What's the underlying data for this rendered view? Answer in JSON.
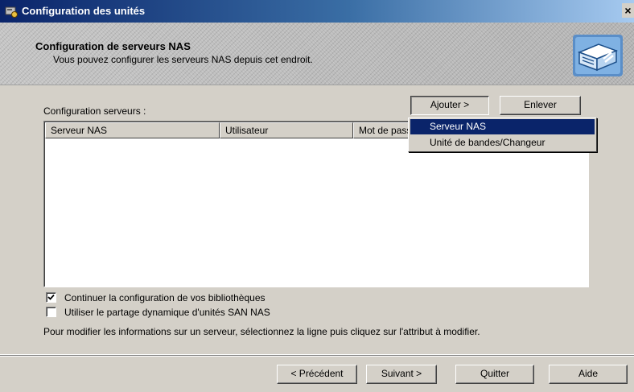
{
  "window": {
    "title": "Configuration des unités",
    "close_glyph": "×"
  },
  "header": {
    "title": "Configuration de serveurs NAS",
    "subtitle": "Vous pouvez configurer les serveurs NAS depuis cet endroit.",
    "art_icon": "tape-library-icon"
  },
  "main": {
    "list_label": "Configuration serveurs :",
    "buttons": {
      "add": "Ajouter >",
      "remove": "Enlever"
    },
    "columns": [
      "Serveur NAS",
      "Utilisateur",
      "Mot de passe"
    ],
    "rows": [],
    "add_menu": {
      "items": [
        "Serveur NAS",
        "Unité de bandes/Changeur"
      ],
      "selected_index": 0
    },
    "checkboxes": [
      {
        "label": "Continuer la configuration de vos bibliothèques",
        "checked": true
      },
      {
        "label": "Utiliser le partage dynamique d'unités SAN NAS",
        "checked": false
      }
    ],
    "hint": "Pour modifier les informations sur un serveur, sélectionnez la ligne puis cliquez sur l'attribut à modifier."
  },
  "footer": {
    "back": "< Précédent",
    "next": "Suivant >",
    "quit": "Quitter",
    "help": "Aide"
  },
  "colors": {
    "title_bar_start": "#0a246a",
    "title_bar_end": "#a6caf0",
    "dialog_face": "#d4d0c8",
    "selection": "#0a246a"
  }
}
